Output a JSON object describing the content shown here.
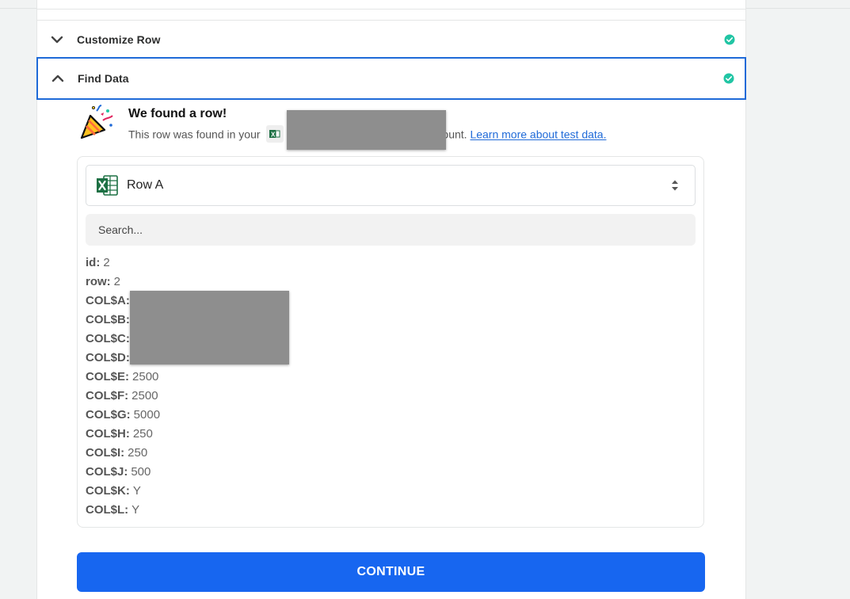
{
  "steps": {
    "customize": {
      "title": "Customize Row",
      "status": "complete"
    },
    "find": {
      "title": "Find Data",
      "status": "complete"
    }
  },
  "found": {
    "title": "We found a row!",
    "sub_before": "This row was found in your",
    "sub_after": "ount.",
    "learn_more": "Learn more about test data."
  },
  "record": {
    "selected_label": "Row A",
    "search_placeholder": "Search...",
    "fields": [
      {
        "key": "id:",
        "value": "2"
      },
      {
        "key": "row:",
        "value": "2"
      },
      {
        "key": "COL$A:",
        "value": ""
      },
      {
        "key": "COL$B:",
        "value": ""
      },
      {
        "key": "COL$C:",
        "value": ""
      },
      {
        "key": "COL$D:",
        "value": ""
      },
      {
        "key": "COL$E:",
        "value": "2500"
      },
      {
        "key": "COL$F:",
        "value": "2500"
      },
      {
        "key": "COL$G:",
        "value": "5000"
      },
      {
        "key": "COL$H:",
        "value": "250"
      },
      {
        "key": "COL$I:",
        "value": "250"
      },
      {
        "key": "COL$J:",
        "value": "500"
      },
      {
        "key": "COL$K:",
        "value": "Y"
      },
      {
        "key": "COL$L:",
        "value": "Y"
      }
    ]
  },
  "continue_label": "CONTINUE",
  "icons": {
    "customize_chevron": "chevron-down-icon",
    "find_chevron": "chevron-up-icon",
    "status": "check-circle-icon",
    "celebrate": "party-popper-icon",
    "app": "excel-icon",
    "select": "sort-arrows-icon"
  },
  "colors": {
    "accent": "#1f6ad8",
    "button": "#1766f0",
    "success": "#21c5a4",
    "redaction": "#8e8e8e"
  }
}
